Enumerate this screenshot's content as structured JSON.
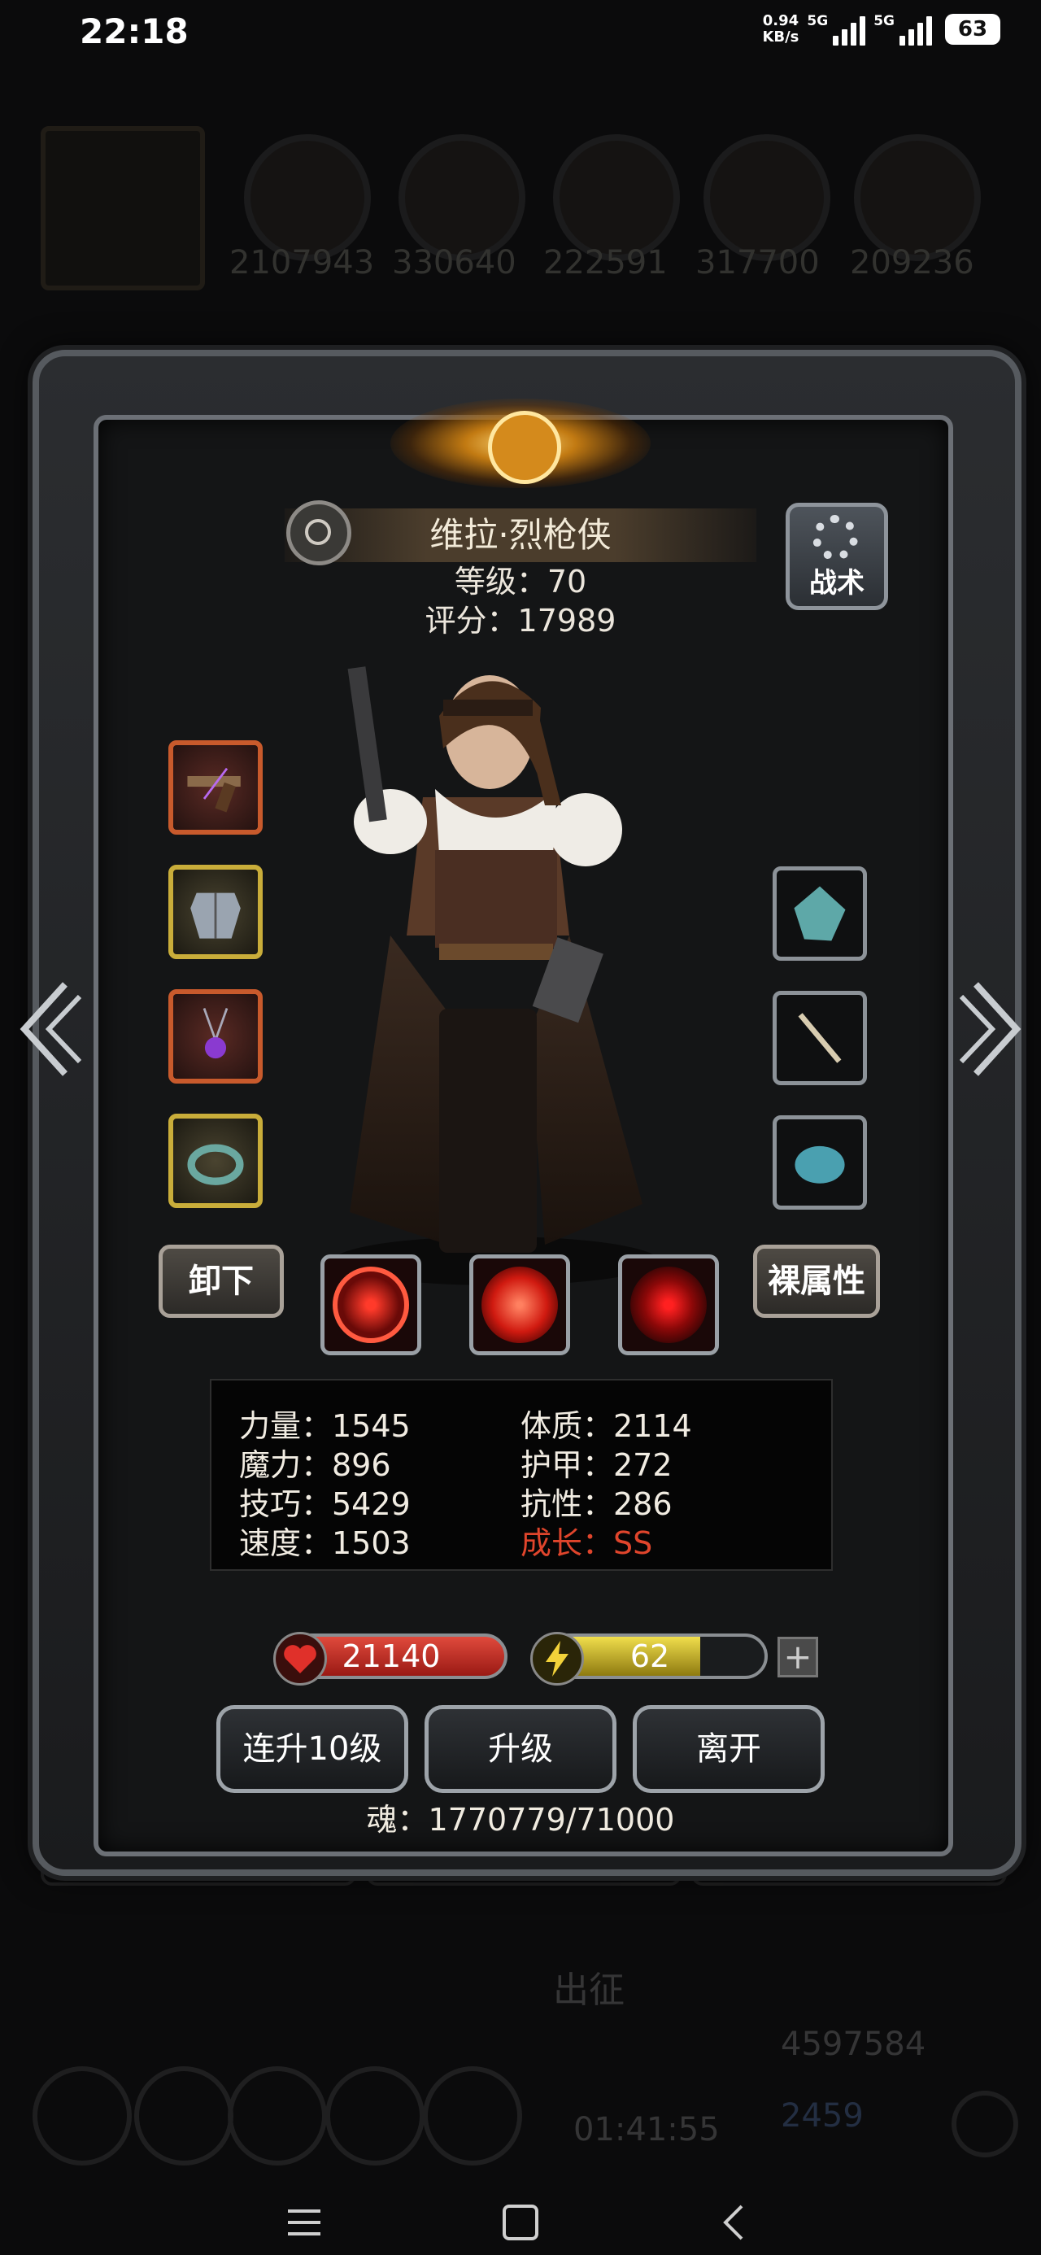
{
  "status_bar": {
    "time": "22:18",
    "speed_value": "0.94",
    "speed_unit": "KB/s",
    "sim1": "5G",
    "sim2": "5G",
    "battery": "63"
  },
  "background": {
    "resources": [
      "2107943",
      "330640",
      "222591",
      "317700",
      "209236"
    ],
    "bottom_label": "出征",
    "bottom_timer": "01:41:55",
    "bottom_gold": "4597584",
    "bottom_gem": "2459"
  },
  "hero": {
    "name": "维拉·烈枪侠",
    "level_text": "等级：70",
    "score_text": "评分：17989"
  },
  "tactics_label": "战术",
  "buttons": {
    "unequip": "卸下",
    "base_stats": "裸属性",
    "level_up_10": "连升10级",
    "level_up": "升级",
    "leave": "离开",
    "plus": "+"
  },
  "stats": {
    "strength": "力量：1545",
    "magic": "魔力：896",
    "skill": "技巧：5429",
    "speed": "速度：1503",
    "constitution": "体质：2114",
    "armor": "护甲：272",
    "resistance": "抗性：286",
    "growth": "成长：SS"
  },
  "hp_value": "21140",
  "energy_value": "62",
  "energy_fraction": 0.72,
  "soul_text": "魂：1770779/71000",
  "colors": {
    "growth": "#e0452c",
    "hp": "#c8302a",
    "energy": "#d8c43a"
  }
}
